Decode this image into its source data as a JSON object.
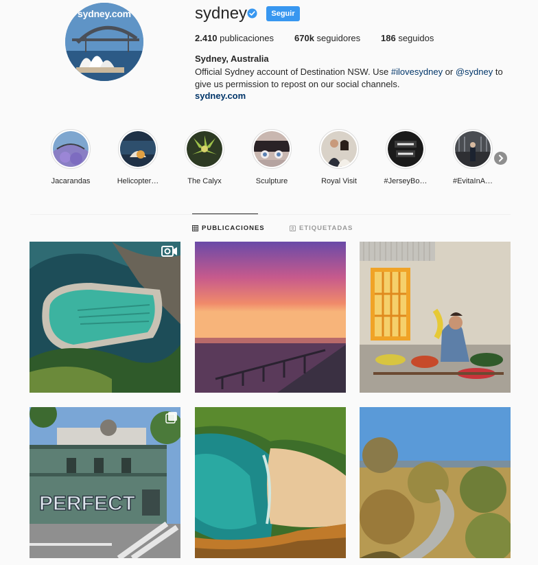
{
  "profile": {
    "avatar_text": "sydney.com",
    "username": "sydney",
    "follow_label": "Seguir",
    "stats": {
      "posts_count": "2.410",
      "posts_label": "publicaciones",
      "followers_count": "670k",
      "followers_label": "seguidores",
      "following_count": "186",
      "following_label": "seguidos"
    },
    "bio": {
      "name": "Sydney, Australia",
      "text_1": "Official Sydney account of Destination NSW. Use ",
      "hashtag": "#ilovesydney",
      "text_2": " or ",
      "mention": "@sydney",
      "text_3": " to give us permission to repost on our social channels.",
      "link": "sydney.com"
    }
  },
  "highlights": [
    {
      "label": "Jacarandas",
      "icon": "jacaranda-photo"
    },
    {
      "label": "Helicopter…",
      "icon": "helicopter-photo"
    },
    {
      "label": "The Calyx",
      "icon": "calyx-photo"
    },
    {
      "label": "Sculpture",
      "icon": "sculpture-photo"
    },
    {
      "label": "Royal Visit",
      "icon": "royal-visit-photo"
    },
    {
      "label": "#JerseyBo…",
      "icon": "jersey-boys-photo"
    },
    {
      "label": "#EvitaInA…",
      "icon": "evita-photo"
    }
  ],
  "tabs": {
    "posts": "PUBLICACIONES",
    "tagged": "ETIQUETADAS"
  },
  "posts": [
    {
      "icon": "ocean-pool-photo",
      "badge": "igtv-icon"
    },
    {
      "icon": "sunset-pier-photo",
      "badge": ""
    },
    {
      "icon": "fruit-stall-mural-photo",
      "badge": ""
    },
    {
      "icon": "perfect-building-photo",
      "badge": "multi-photo-icon"
    },
    {
      "icon": "beach-aerial-photo",
      "badge": ""
    },
    {
      "icon": "bush-boardwalk-photo",
      "badge": ""
    }
  ],
  "colors": {
    "accent": "#3897f0",
    "link": "#003569",
    "background": "#fafafa",
    "text": "#262626"
  }
}
